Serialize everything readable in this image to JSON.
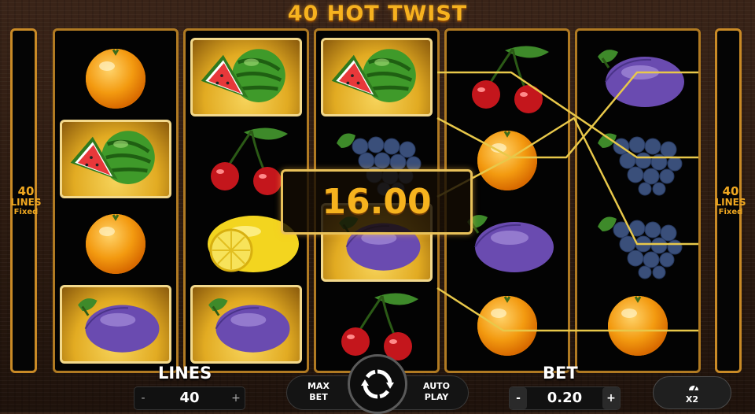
{
  "game": {
    "title": "40 HOT TWIST"
  },
  "side_panels": {
    "left": {
      "count": "40",
      "label": "LINES",
      "sub": "Fixed"
    },
    "right": {
      "count": "40",
      "label": "LINES",
      "sub": "Fixed"
    }
  },
  "reels": [
    [
      "orange",
      "watermelon",
      "orange",
      "plum"
    ],
    [
      "watermelon",
      "cherries",
      "lemon",
      "plum"
    ],
    [
      "watermelon",
      "grapes",
      "plum",
      "cherries"
    ],
    [
      "cherries",
      "orange",
      "plum",
      "orange"
    ],
    [
      "plum",
      "grapes",
      "grapes",
      "orange"
    ]
  ],
  "win": {
    "amount": "16.00"
  },
  "controls": {
    "lines": {
      "label": "LINES",
      "value": "40",
      "minus": "-",
      "plus": "+"
    },
    "bet": {
      "label": "BET",
      "value": "0.20",
      "minus": "-",
      "plus": "+"
    },
    "max_bet": {
      "line1": "MAX",
      "line2": "BET"
    },
    "auto_play": {
      "line1": "AUTO",
      "line2": "PLAY"
    },
    "spin_icon": "refresh-icon",
    "turbo": {
      "label": "X2",
      "icon": "turbo-icon"
    }
  },
  "colors": {
    "gold": "#f6b21f",
    "reel_border": "#b07a22",
    "payline": "#e8c84a",
    "win_highlight": "#e2ab22"
  }
}
